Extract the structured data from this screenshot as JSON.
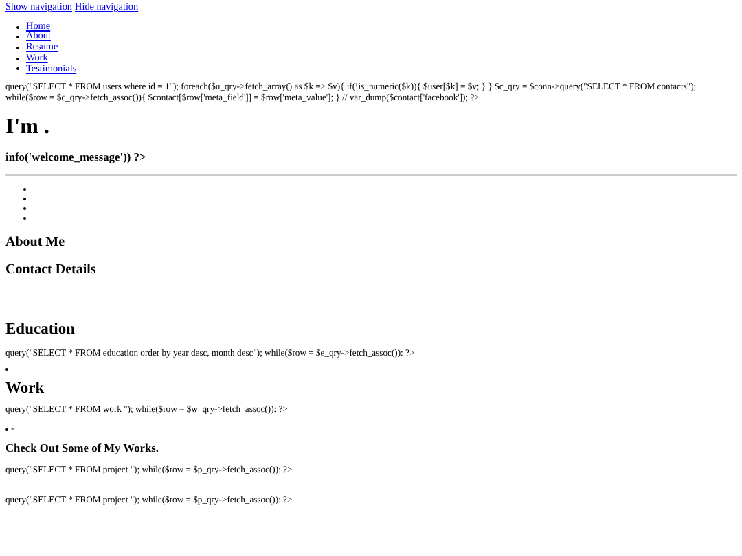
{
  "top_links": [
    "Show navigation",
    "Hide navigation"
  ],
  "nav": [
    "Home",
    "About",
    "Resume",
    "Work",
    "Testimonials"
  ],
  "php_code": "query(\"SELECT * FROM users where id = 1\"); foreach($u_qry->fetch_array() as $k => $v){ if(!is_numeric($k)){ $user[$k] = $v; } } $c_qry = $conn->query(\"SELECT * FROM contacts\"); while($row = $c_qry->fetch_assoc()){ $contact[$row['meta_field']] = $row['meta_value']; } // var_dump($contact['facebook']); ?>",
  "hero_title": "I'm .",
  "hero_subtitle": "info('welcome_message')) ?>",
  "about_heading": "About Me",
  "contact_heading": "Contact Details",
  "education": {
    "heading": "Education",
    "code": "query(\"SELECT * FROM education order by year desc, month desc\"); while($row = $e_qry->fetch_assoc()): ?>"
  },
  "work": {
    "heading": "Work",
    "code": "query(\"SELECT * FROM work \"); while($row = $w_qry->fetch_assoc()): ?>",
    "dash": "-"
  },
  "projects": {
    "heading": "Check Out Some of My Works.",
    "code": [
      "query(\"SELECT * FROM project \"); while($row = $p_qry->fetch_assoc()): ?>",
      "query(\"SELECT * FROM project \"); while($row = $p_qry->fetch_assoc()): ?>"
    ]
  }
}
